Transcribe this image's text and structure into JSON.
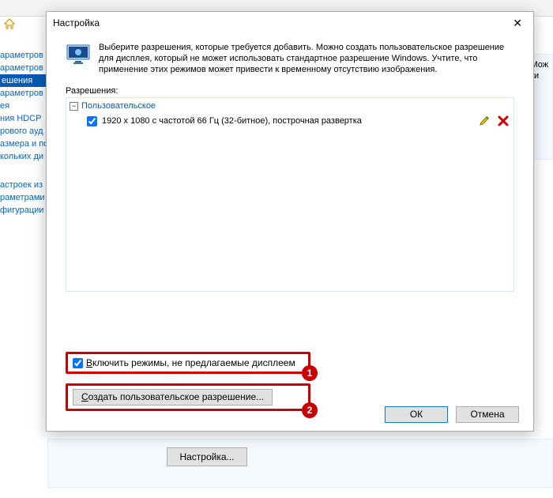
{
  "bg": {
    "nav": [
      "араметров",
      "араметров",
      "ешения",
      "араметров",
      "ея",
      "ния HDCP",
      "рового ауд",
      "азмера и по",
      "кольких ди"
    ],
    "nav_selected_index": 2,
    "nav2": [
      "астроек из",
      "раметрами",
      "фигурации"
    ],
    "right_panel": [
      "ние. Мож",
      "телеви"
    ],
    "bottom_button": "Настройка..."
  },
  "dialog": {
    "title": "Настройка",
    "intro": "Выберите разрешения, которые требуется добавить. Можно создать пользовательское разрешение для дисплея, который не может использовать стандартное разрешение Windows. Учтите, что применение этих режимов может привести к временному отсутствию изображения.",
    "section_caption": "Разрешения:",
    "group_label": "Пользовательское",
    "resolution_rows": [
      {
        "checked": true,
        "label": "1920 x 1080 с частотой 66 Гц (32-битное), построчная развертка"
      }
    ],
    "enable_modes_before_underline": "В",
    "enable_modes_after_underline": "ключить режимы, не предлагаемые дисплеем",
    "enable_modes_checked": true,
    "create_button_before_underline": "С",
    "create_button_after_underline": "оздать пользовательское разрешение...",
    "ok": "ОК",
    "cancel": "Отмена",
    "badge1": "1",
    "badge2": "2"
  }
}
